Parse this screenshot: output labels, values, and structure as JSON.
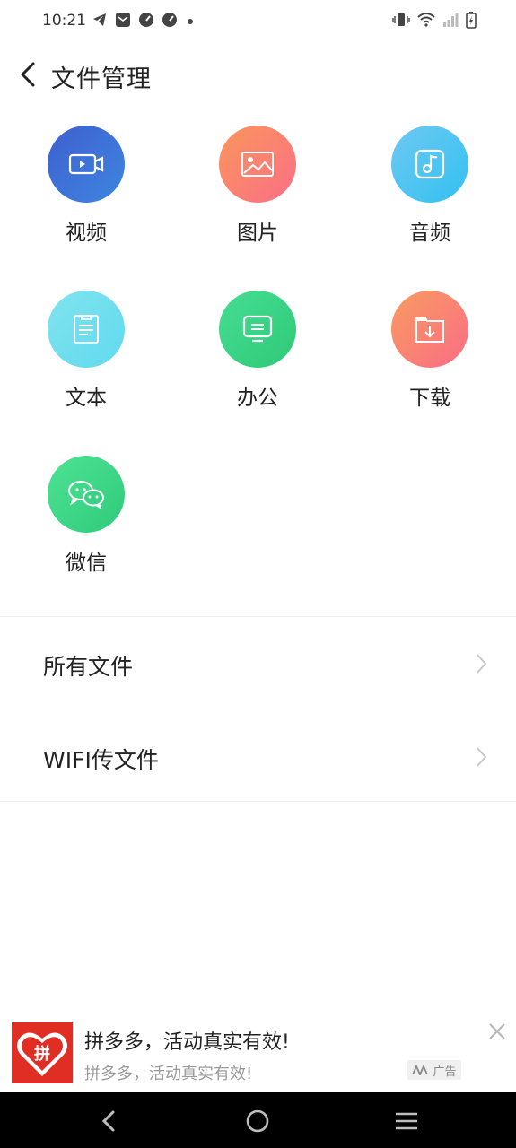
{
  "status_bar": {
    "time": "10:21",
    "icons_left": [
      "telegram-icon",
      "mail-icon",
      "speedometer-icon",
      "speedometer-icon",
      "dot-icon"
    ],
    "icons_right": [
      "vibrate-icon",
      "wifi-icon",
      "signal-icon",
      "battery-charging-icon"
    ]
  },
  "header": {
    "title": "文件管理"
  },
  "categories": [
    {
      "label": "视频",
      "icon": "video-camera-icon"
    },
    {
      "label": "图片",
      "icon": "image-icon"
    },
    {
      "label": "音频",
      "icon": "music-note-icon"
    },
    {
      "label": "文本",
      "icon": "document-icon"
    },
    {
      "label": "办公",
      "icon": "monitor-icon"
    },
    {
      "label": "下载",
      "icon": "download-folder-icon"
    },
    {
      "label": "微信",
      "icon": "wechat-icon"
    }
  ],
  "list": [
    {
      "label": "所有文件"
    },
    {
      "label": "WIFI传文件"
    }
  ],
  "ad": {
    "title": "拼多多，活动真实有效!",
    "subtitle": "拼多多，活动真实有效!",
    "badge": "广告",
    "logo_text": "拼"
  },
  "colors": {
    "accent_blue": "#3d6fd9",
    "accent_orange": "#fa8470",
    "accent_cyan": "#4fc6f2",
    "accent_green": "#35d180",
    "ad_red": "#e02e24"
  }
}
